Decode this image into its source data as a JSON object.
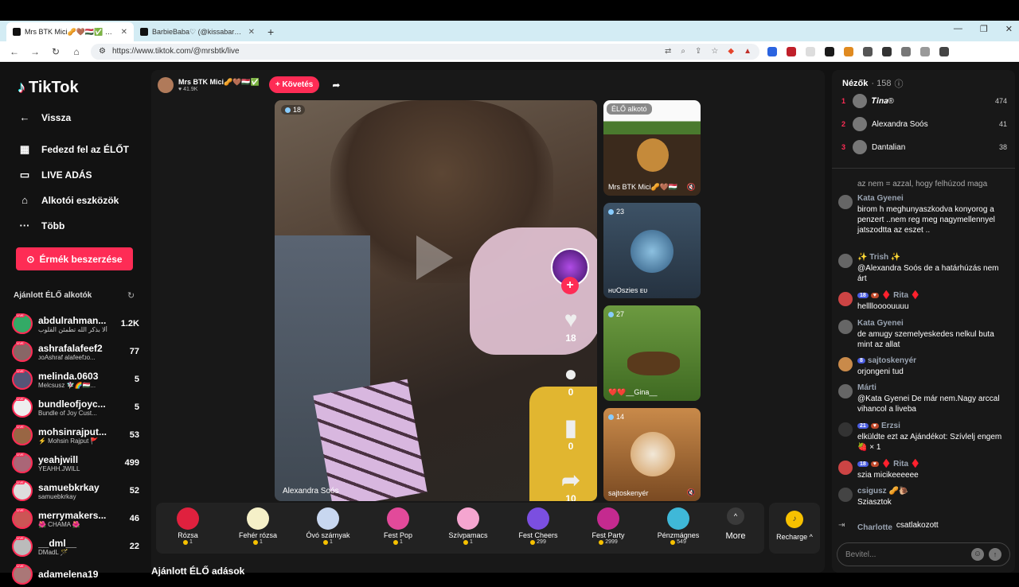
{
  "browser": {
    "tabs": [
      {
        "title": "Mrs BTK Mici🥜🤎🇭🇺✅ @m"
      },
      {
        "title": "BarbieBaba♡ (@kissabarbie) ÉLŐ ad"
      }
    ],
    "url": "https://www.tiktok.com/@mrsbtk/live"
  },
  "sidebar": {
    "logo": "TikTok",
    "back": "Vissza",
    "nav": [
      "Fedezd fel az ÉLŐT",
      "LIVE ADÁS",
      "Alkotói eszközök",
      "Több"
    ],
    "coins_button": "Érmék beszerzése",
    "recommended_title": "Ajánlott ÉLŐ alkotók",
    "recommended": [
      {
        "name": "abdulrahman...",
        "sub": "ألا بذكر الله تطمئن القلوب",
        "count": "1.2K"
      },
      {
        "name": "ashrafalafeef2",
        "sub": "ᴊᴏAshraf alafeefᴊᴏ...",
        "count": "77"
      },
      {
        "name": "melinda.0603",
        "sub": "Melcsusz 🧚🏻‍♀️🌈🇭🇺...",
        "count": "5"
      },
      {
        "name": "bundleofjoyc...",
        "sub": "Bundle of Joy Cust...",
        "count": "5"
      },
      {
        "name": "mohsinrajput...",
        "sub": "⚡ Mohsin Rajput 🚩",
        "count": "53"
      },
      {
        "name": "yeahjwill",
        "sub": "YEAHH.JWILL",
        "count": "499"
      },
      {
        "name": "samuebkrkay",
        "sub": "samuebkrkay",
        "count": "52"
      },
      {
        "name": "merrymakers...",
        "sub": "🌺 CHAMA 🌺",
        "count": "46"
      },
      {
        "name": "__dml__",
        "sub": "DMadL 🪄",
        "count": "22"
      },
      {
        "name": "adamelena19",
        "sub": "",
        "count": ""
      }
    ]
  },
  "stream": {
    "host_name": "Mrs BTK Mici🥜🤎🇭🇺✅",
    "host_likes": "♥ 41.9K",
    "follow_label": "+ Követés",
    "viewers": "18",
    "player_name": "Alexandra Soós",
    "likes": "18",
    "comments": "0",
    "bookmarks": "0",
    "shares": "10"
  },
  "previews": [
    {
      "tag": "ÉLŐ alkotó",
      "label": "Mrs BTK Mici🥜🤎🇭🇺",
      "count": ""
    },
    {
      "count": "23",
      "label": "ʜᴜOszies ᴇᴜ"
    },
    {
      "count": "27",
      "label": "❤️❤️__Gina__"
    },
    {
      "count": "14",
      "label": "sajtoskenyér"
    }
  ],
  "gifts": [
    {
      "name": "Rózsa",
      "price": "1",
      "color": "#e0213e"
    },
    {
      "name": "Fehér rózsa",
      "price": "1",
      "color": "#f5f0c8"
    },
    {
      "name": "Óvó szárnyak",
      "price": "1",
      "color": "#c8d7f0"
    },
    {
      "name": "Fest Pop",
      "price": "1",
      "color": "#e24a9a"
    },
    {
      "name": "Szívpamacs",
      "price": "1",
      "color": "#f5a5d0"
    },
    {
      "name": "Fest Cheers",
      "price": "299",
      "color": "#7b4fe0"
    },
    {
      "name": "Fest Party",
      "price": "2999",
      "color": "#c42a8f"
    },
    {
      "name": "Pénzmágnes",
      "price": "549",
      "color": "#3fb8d8"
    }
  ],
  "more_label": "More",
  "recharge_label": "Recharge ^",
  "bottom_title": "Ajánlott ÉLŐ adások",
  "chat": {
    "viewers_label": "Nézők",
    "viewers_count": "· 158",
    "top": [
      {
        "rank": "1",
        "name": "𝑻𝒊𝒏𝒂®",
        "score": "474"
      },
      {
        "rank": "2",
        "name": "Alexandra Soós",
        "score": "41"
      },
      {
        "rank": "3",
        "name": "Dantalian",
        "score": "38"
      }
    ],
    "messages": [
      {
        "user": "",
        "text": "az nem = azzal, hogy felhúzod maga"
      },
      {
        "user": "Kata Gyenei",
        "text": "birom h meghunyaszkodva konyorog a penzert ..nem reg meg nagymellennyel jatszodtta az eszet .."
      },
      {
        "user": "✨ Trish ✨",
        "text": "@Alexandra Soós de a határhúzás nem árt"
      },
      {
        "user": "♦️ Rita ♦️",
        "text": "helllloooouuuu"
      },
      {
        "user": "Kata Gyenei",
        "text": "de amugy szemelyeskedes nelkul buta mint az allat"
      },
      {
        "user": "sajtoskenyér",
        "text": "orjongeni tud"
      },
      {
        "user": "Márti",
        "text": "@Kata Gyenei De már nem.Nagy arccal vihancol a liveba"
      },
      {
        "user": "Erzsi",
        "text": "elküldte ezt az Ajándékot: Szívlelj engem 🍓 × 1"
      },
      {
        "user": "♦️ Rita ♦️",
        "text": "szia micikeeeeee"
      },
      {
        "user": "csigusz 🥜🐌",
        "text": "Sziasztok"
      },
      {
        "user": "Charlotte",
        "text": "csatlakozott"
      }
    ],
    "input_placeholder": "Bevitel..."
  }
}
